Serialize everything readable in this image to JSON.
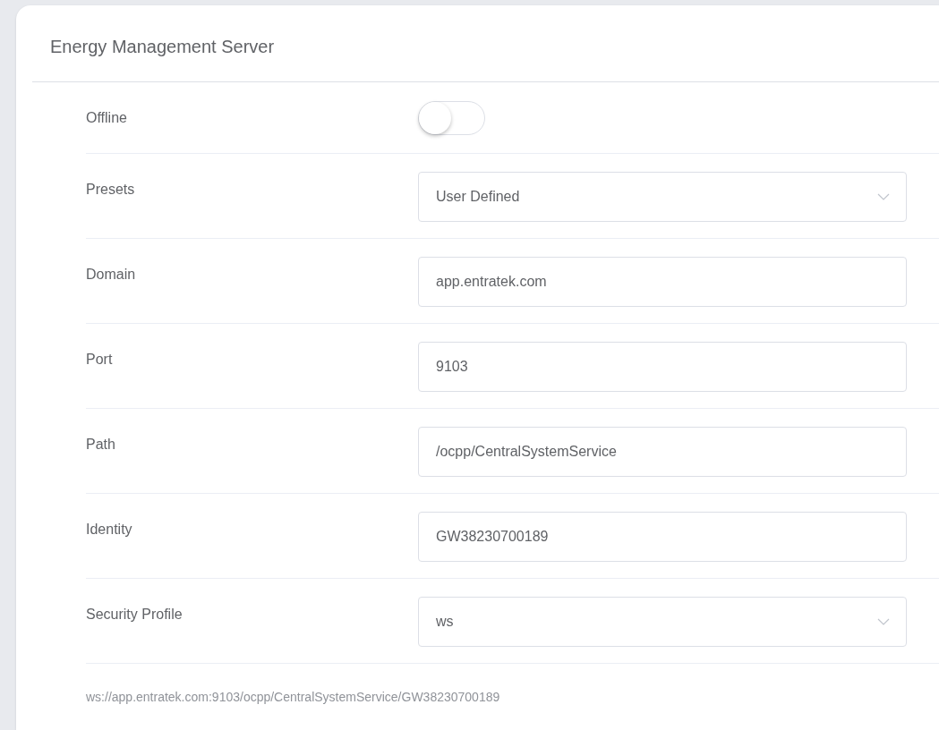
{
  "panel": {
    "title": "Energy Management Server",
    "fields": [
      {
        "kind": "toggle",
        "label": "Offline",
        "on": false
      },
      {
        "kind": "select",
        "label": "Presets",
        "value": "User Defined"
      },
      {
        "kind": "input",
        "label": "Domain",
        "value": "app.entratek.com"
      },
      {
        "kind": "input",
        "label": "Port",
        "value": "9103"
      },
      {
        "kind": "input",
        "label": "Path",
        "value": "/ocpp/CentralSystemService"
      },
      {
        "kind": "input",
        "label": "Identity",
        "value": "GW38230700189"
      },
      {
        "kind": "select",
        "label": "Security Profile",
        "value": "ws"
      }
    ],
    "url": "ws://app.entratek.com:9103/ocpp/CentralSystemService/GW38230700189"
  }
}
